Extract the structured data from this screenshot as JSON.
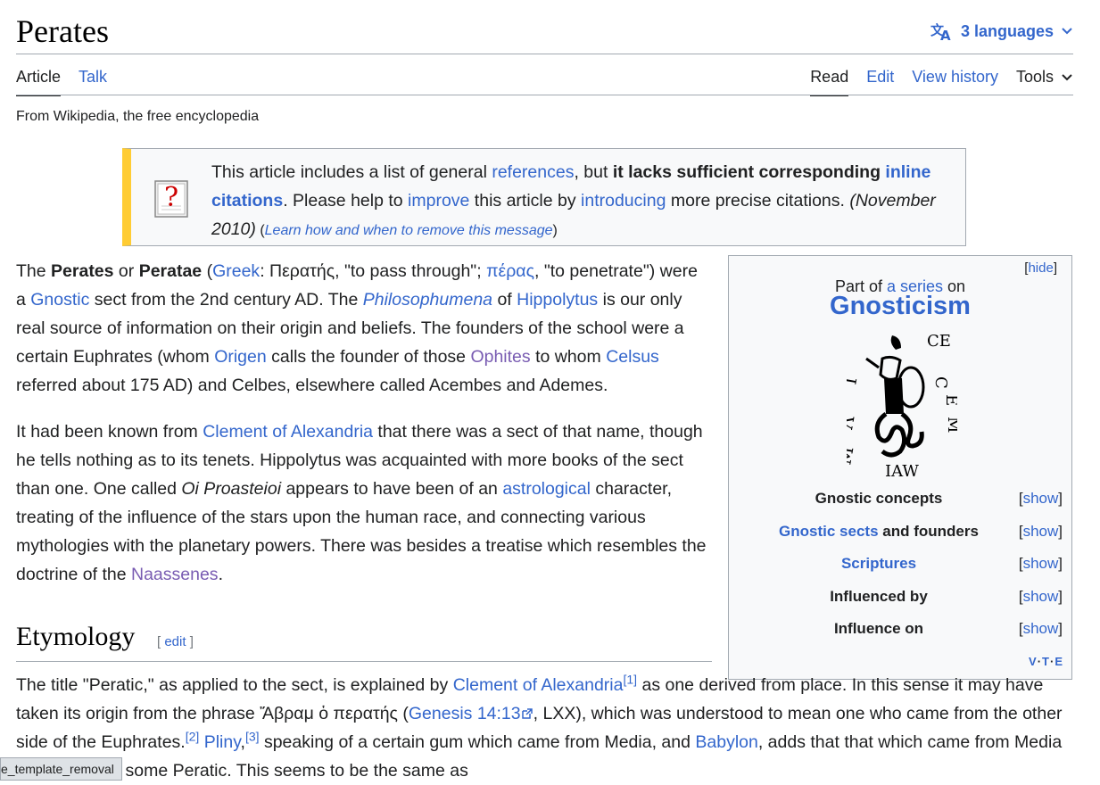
{
  "page": {
    "title": "Perates",
    "languages_label": "3 languages",
    "tabs_left": [
      "Article",
      "Talk"
    ],
    "tabs_right": [
      "Read",
      "Edit",
      "View history",
      "Tools"
    ],
    "tagline": "From Wikipedia, the free encyclopedia"
  },
  "ambox": {
    "t1": "This article includes a list of general ",
    "l1": "references",
    "t2": ", but ",
    "b1": "it lacks sufficient corresponding ",
    "l2": "inline citations",
    "t3": ". Please help to ",
    "l3": "improve",
    "t4": " this article by ",
    "l4": "introducing",
    "t5": " more precise citations. ",
    "date": "(November 2010)",
    "t6": " (",
    "l5": "Learn how and when to remove this message",
    "t7": ")"
  },
  "infobox": {
    "hide": "hide",
    "part_of_pre": "Part of ",
    "part_of_link": "a series",
    "part_of_post": " on",
    "title": "Gnosticism",
    "image_caption_text": "IAW",
    "rows": [
      {
        "label": "Gnostic concepts",
        "show": "show"
      },
      {
        "label_link": "Gnostic sects",
        "label_rest": " and founders",
        "show": "show"
      },
      {
        "label": "Scriptures",
        "show": "show"
      },
      {
        "label": "Influenced by",
        "show": "show"
      },
      {
        "label": "Influence on",
        "show": "show"
      }
    ],
    "vte": [
      "V",
      "T",
      "E"
    ]
  },
  "p1": {
    "a": "The ",
    "b1": "Perates",
    "c": " or ",
    "b2": "Peratae",
    "d": " (",
    "l_greek": "Greek",
    "e": ": Περατής, \"to pass through\"; ",
    "l_peras": "πέρας",
    "f": ", \"to penetrate\") were a ",
    "l_gnostic": "Gnostic",
    "g": " sect from the 2nd century AD. The ",
    "l_philo": "Philosophumena",
    "h": " of ",
    "l_hipp": "Hippolytus",
    "i": " is our only real source of information on their origin and beliefs. The founders of the school were a certain Euphrates (whom ",
    "l_origen": "Origen",
    "j": " calls the founder of those ",
    "l_ophites": "Ophites",
    "k": " to whom ",
    "l_celsus": "Celsus",
    "m": " referred about 175 AD) and Celbes, elsewhere called Acembes and Ademes."
  },
  "p2": {
    "a": "It had been known from ",
    "l_clement": "Clement of Alexandria",
    "b": " that there was a sect of that name, though he tells nothing as to its tenets. Hippolytus was acquainted with more books of the sect than one. One called ",
    "i_oi": "Oi Proasteioi",
    "c": " appears to have been of an ",
    "l_astro": "astrological",
    "d": " character, treating of the influence of the stars upon the human race, and connecting various mythologies with the planetary powers. There was besides a treatise which resembles the doctrine of the ",
    "l_naas": "Naassenes",
    "e": "."
  },
  "etymology": {
    "heading": "Etymology",
    "edit_open": "[ ",
    "edit": "edit",
    "edit_close": " ]",
    "a": "The title \"Peratic,\" as applied to the sect, is explained by ",
    "l_clement": "Clement of Alexandria",
    "ref1": "[1]",
    "b": " as one derived from place. In this sense it may have taken its origin from the phrase Ἄβραμ ὁ περατής (",
    "l_gen": "Genesis 14:13",
    "c": ", LXX), which was understood to mean one who came from the other side of the Euphrates.",
    "ref2": "[2]",
    "l_pliny": "Pliny",
    "comma": ",",
    "ref3": "[3]",
    "d": " speaking of a certain gum which came from Media, and ",
    "l_babylon": "Babylon",
    "e": ", adds that that which came from Media was called by some Peratic. This seems to be the same as"
  },
  "status_bar": "e_template_removal"
}
